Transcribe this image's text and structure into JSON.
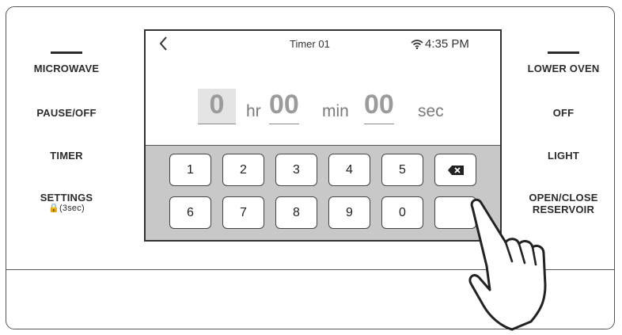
{
  "left_keys": [
    {
      "label": "MICROWAVE",
      "sub": ""
    },
    {
      "label": "PAUSE/OFF",
      "sub": ""
    },
    {
      "label": "TIMER",
      "sub": ""
    },
    {
      "label": "SETTINGS",
      "sub": "🔒(3sec)"
    }
  ],
  "right_keys": [
    {
      "label": "LOWER OVEN"
    },
    {
      "label": "OFF"
    },
    {
      "label": "LIGHT"
    },
    {
      "label": "OPEN/CLOSE",
      "label2": "RESERVOIR"
    }
  ],
  "screen": {
    "title": "Timer 01",
    "time": "4:35 PM",
    "hours": "0",
    "hours_unit": "hr",
    "minutes": "00",
    "minutes_unit": "min",
    "seconds": "00",
    "seconds_unit": "sec"
  },
  "keypad": {
    "row1": [
      "1",
      "2",
      "3",
      "4",
      "5"
    ],
    "row2": [
      "6",
      "7",
      "8",
      "9",
      "0"
    ]
  },
  "icons": [
    "back-icon",
    "wifi-icon",
    "backspace-icon",
    "pointing-hand-icon"
  ]
}
